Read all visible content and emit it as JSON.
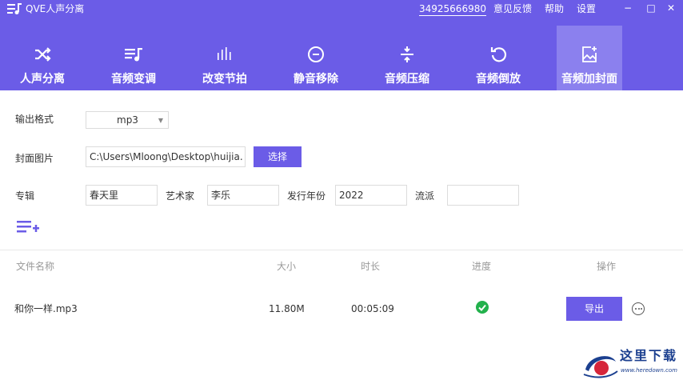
{
  "window": {
    "app_title": "QVE人声分离",
    "phone": "34925666980",
    "links": [
      "意见反馈",
      "帮助",
      "设置"
    ],
    "controls": {
      "minimize": "−",
      "maximize": "□",
      "close": "✕"
    }
  },
  "nav": {
    "tabs": [
      {
        "label": "人声分离",
        "icon": "shuffle-icon"
      },
      {
        "label": "音频变调",
        "icon": "playlist-music-icon"
      },
      {
        "label": "改变节拍",
        "icon": "equalizer-bars-icon"
      },
      {
        "label": "静音移除",
        "icon": "minus-circle-icon"
      },
      {
        "label": "音频压缩",
        "icon": "compress-arrows-icon"
      },
      {
        "label": "音频倒放",
        "icon": "rotate-ccw-icon"
      },
      {
        "label": "音频加封面",
        "icon": "image-add-icon",
        "active": true
      }
    ]
  },
  "form": {
    "output_format_label": "输出格式",
    "output_format_value": "mp3",
    "cover_label": "封面图片",
    "cover_path": "C:\\Users\\Mloong\\Desktop\\huijia.",
    "choose_button": "选择",
    "album_label": "专辑",
    "album_value": "春天里",
    "artist_label": "艺术家",
    "artist_value": "李乐",
    "year_label": "发行年份",
    "year_value": "2022",
    "genre_label": "流派",
    "genre_value": ""
  },
  "table": {
    "headers": {
      "name": "文件名称",
      "size": "大小",
      "duration": "时长",
      "progress": "进度",
      "action": "操作"
    },
    "rows": [
      {
        "name": "和你一样.mp3",
        "size": "11.80M",
        "duration": "00:05:09",
        "progress_status": "complete",
        "export_label": "导出"
      }
    ]
  },
  "watermark": {
    "text": "这里下载",
    "url": "www.heredown.com"
  },
  "colors": {
    "accent": "#6b5ce7",
    "active_tab": "#8b80ee",
    "success": "#22b14c"
  }
}
